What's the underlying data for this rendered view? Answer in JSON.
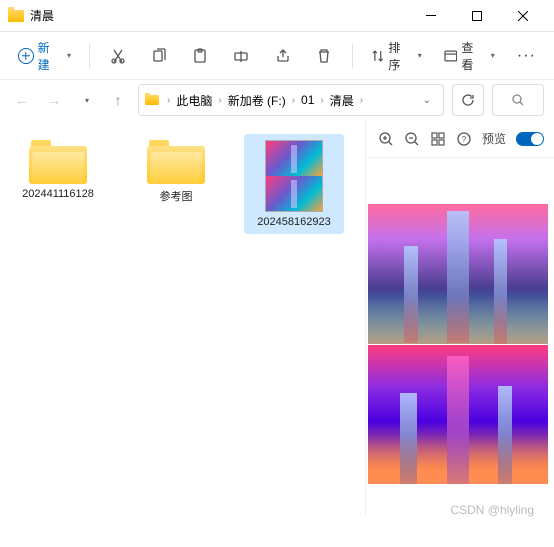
{
  "window": {
    "title": "清晨"
  },
  "toolbar": {
    "new_label": "新建",
    "sort_label": "排序",
    "view_label": "查看"
  },
  "breadcrumb": {
    "items": [
      "此电脑",
      "新加卷 (F:)",
      "01",
      "清晨"
    ]
  },
  "items": [
    {
      "name": "202441116128",
      "type": "folder"
    },
    {
      "name": "参考图",
      "type": "folder"
    },
    {
      "name": "202458162923",
      "type": "image",
      "selected": true
    }
  ],
  "preview": {
    "label": "预览"
  },
  "watermark": "CSDN @hlyling"
}
